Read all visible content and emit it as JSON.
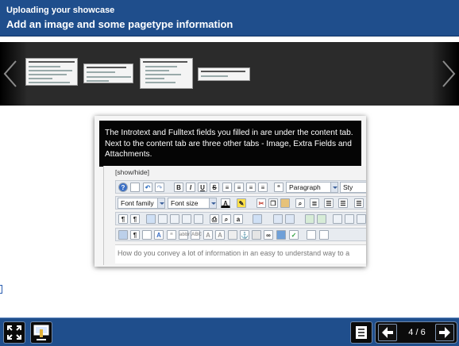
{
  "header": {
    "subtitle": "Uploading your showcase",
    "title": "Add an image and some pagetype information"
  },
  "filmstrip": {
    "thumbnail_count": 4
  },
  "slide": {
    "caption": "The Introtext and Fulltext fields you filled in are under the content tab. Next to the content tab are three other tabs - Image, Extra Fields and Attachments.",
    "show_hide": "[show/hide]",
    "paragraph_select": "Paragraph",
    "style_select": "Sty",
    "font_family_select": "Font family",
    "font_size_select": "Font size",
    "editor_text": "How do you convey a lot of information in an easy to understand way to a"
  },
  "footer": {
    "page_counter": "4 / 6"
  },
  "colors": {
    "header_bg": "#1f4e8c",
    "strip_bg": "#2b2b2b",
    "caption_bg": "#050505"
  }
}
